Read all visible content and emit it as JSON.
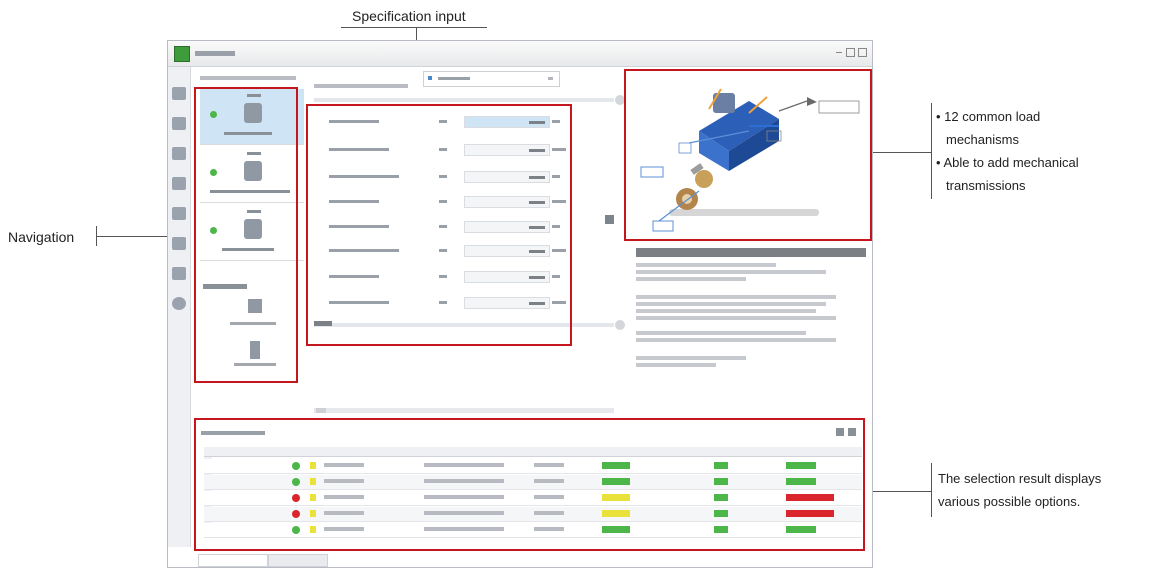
{
  "annotations": {
    "spec_input": "Specification input",
    "navigation": "Navigation",
    "mech_line1": "• 12 common load",
    "mech_line2": "mechanisms",
    "mech_line3": "• Able to add mechanical",
    "mech_line4": "transmissions",
    "result_line1": "The selection result displays",
    "result_line2": "various possible options."
  },
  "colors": {
    "annotation_red": "#c4161c",
    "status_green": "#4cb648",
    "status_red": "#d9252b",
    "status_yellow": "#e9e23a",
    "selection_blue": "#cfe5f6"
  },
  "icons": [
    "app-icon",
    "step-icon",
    "motor-icon",
    "load-mechanism-illustration",
    "status-ok-icon",
    "status-error-icon",
    "status-warning-icon"
  ],
  "result_rows": [
    {
      "status": "ok",
      "bar1": "green",
      "bar2": "green",
      "bar3": "green"
    },
    {
      "status": "ok",
      "bar1": "green",
      "bar2": "green",
      "bar3": "green"
    },
    {
      "status": "error",
      "bar1": "yellow",
      "bar2": "green",
      "bar3": "red"
    },
    {
      "status": "error",
      "bar1": "yellow",
      "bar2": "green",
      "bar3": "red"
    },
    {
      "status": "ok",
      "bar1": "green",
      "bar2": "green",
      "bar3": "green"
    }
  ]
}
